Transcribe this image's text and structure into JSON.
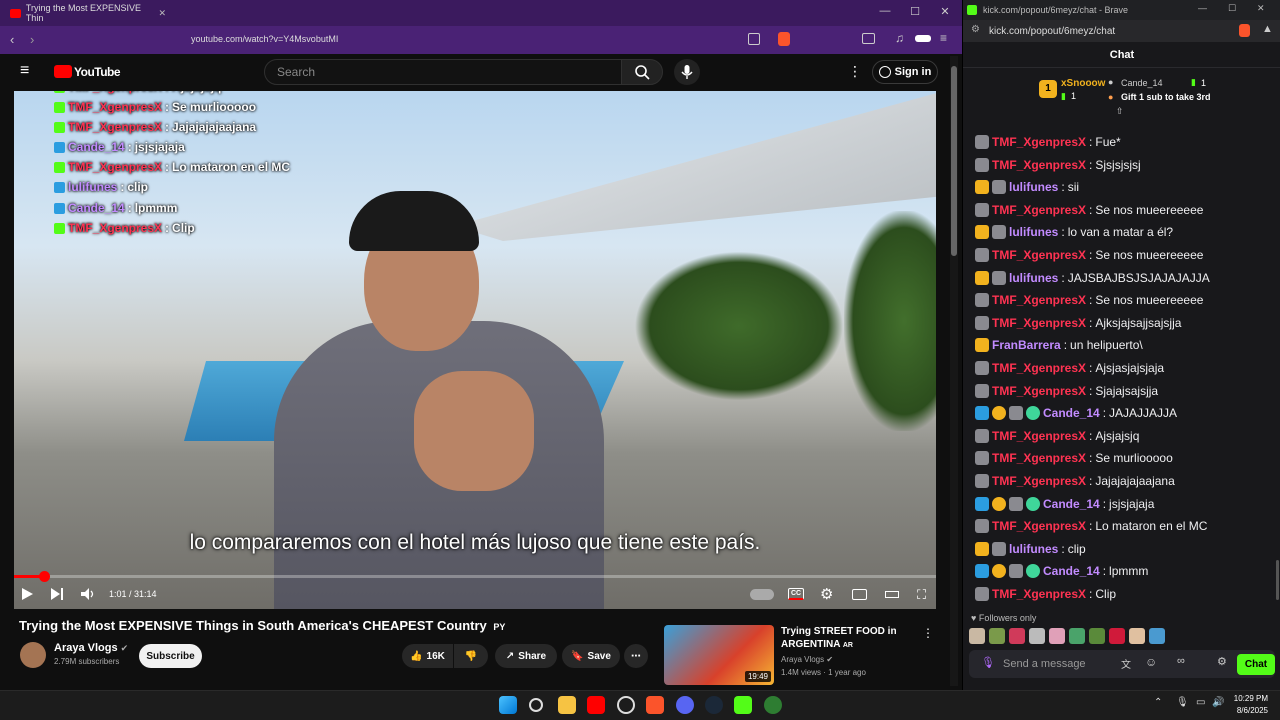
{
  "left_window": {
    "tab_title": "Trying the Most EXPENSIVE Thin",
    "url": "youtube.com/watch?v=Y4MsvobutMI",
    "controls": [
      "—",
      "☐",
      "✕"
    ]
  },
  "youtube": {
    "logo": "YouTube",
    "search_placeholder": "Search",
    "sign_in": "Sign in",
    "subtitle": "lo compararemos con el hotel más lujoso que tiene este país.",
    "time": "1:01 / 31:14",
    "progress_fraction": 0.033,
    "title": "Trying the Most EXPENSIVE Things in South America's CHEAPEST Country",
    "title_badge": "PY",
    "channel": "Araya Vlogs",
    "subscribers": "2.79M subscribers",
    "subscribe": "Subscribe",
    "likes": "16K",
    "share": "Share",
    "save": "Save",
    "recommended": {
      "title": "Trying STREET FOOD in ARGENTINA",
      "title_badge": "AR",
      "channel": "Araya Vlogs",
      "meta": "1.4M views · 1 year ago",
      "duration": "19:49"
    }
  },
  "overlay_chat": [
    {
      "name": "FranBarrera",
      "msg": "un helipuerto\\",
      "color": "gold"
    },
    {
      "name": "TMF_XgenpresX",
      "msg": "Ajsjasjajsjaja",
      "color": "red"
    },
    {
      "name": "TMF_XgenpresX",
      "msg": "Sjajajsajsjja",
      "color": "red"
    },
    {
      "name": "Cande_14",
      "msg": "JAJAJJAJJA",
      "color": "purple"
    },
    {
      "name": "TMF_XgenpresX",
      "msg": "Ajsjajsjq",
      "color": "red"
    },
    {
      "name": "TMF_XgenpresX",
      "msg": "Se murliooooo",
      "color": "red"
    },
    {
      "name": "TMF_XgenpresX",
      "msg": "Jajajajajaajana",
      "color": "red"
    },
    {
      "name": "Cande_14",
      "msg": "jsjsjajaja",
      "color": "purple"
    },
    {
      "name": "TMF_XgenpresX",
      "msg": "Lo mataron en el MC",
      "color": "red"
    },
    {
      "name": "lulifunes",
      "msg": "clip",
      "color": "purple"
    },
    {
      "name": "Cande_14",
      "msg": "lpmmm",
      "color": "purple"
    },
    {
      "name": "TMF_XgenpresX",
      "msg": "Clip",
      "color": "red"
    }
  ],
  "right_window": {
    "tab_title": "kick.com/popout/6meyz/chat - Brave",
    "url": "kick.com/popout/6meyz/chat",
    "header": "Chat",
    "pinned": {
      "leader_name": "xSnooow",
      "leader_count": "1",
      "second_name": "Cande_14",
      "second_count": "1",
      "gift_text": "Gift 1 sub to take 3rd"
    },
    "followers_only": "Followers only",
    "input_placeholder": "Send a message",
    "chat_button": "Chat"
  },
  "chat_messages": [
    {
      "name": "TMF_XgenpresX",
      "msg": "Fue*",
      "color": "#ff3352",
      "badges": [
        "shield"
      ]
    },
    {
      "name": "TMF_XgenpresX",
      "msg": "Sjsjsjsjsj",
      "color": "#ff3352",
      "badges": [
        "shield"
      ]
    },
    {
      "name": "lulifunes",
      "msg": "sii",
      "color": "#c28bff",
      "badges": [
        "crown",
        "shield"
      ]
    },
    {
      "name": "TMF_XgenpresX",
      "msg": "Se nos mueereeeee",
      "color": "#ff3352",
      "badges": [
        "shield"
      ]
    },
    {
      "name": "lulifunes",
      "msg": "lo van a matar a él?",
      "color": "#c28bff",
      "badges": [
        "crown",
        "shield"
      ]
    },
    {
      "name": "TMF_XgenpresX",
      "msg": "Se nos mueereeeee",
      "color": "#ff3352",
      "badges": [
        "shield"
      ]
    },
    {
      "name": "lulifunes",
      "msg": "JAJSBAJBSJSJAJAJAJJA",
      "color": "#c28bff",
      "badges": [
        "crown",
        "shield"
      ]
    },
    {
      "name": "TMF_XgenpresX",
      "msg": "Se nos mueereeeee",
      "color": "#ff3352",
      "badges": [
        "shield"
      ]
    },
    {
      "name": "TMF_XgenpresX",
      "msg": "Ajksjajsajjsajsjja",
      "color": "#ff3352",
      "badges": [
        "shield"
      ]
    },
    {
      "name": "FranBarrera",
      "msg": "un helipuerto\\",
      "color": "#c28bff",
      "badges": [
        "crown"
      ]
    },
    {
      "name": "TMF_XgenpresX",
      "msg": "Ajsjasjajsjaja",
      "color": "#ff3352",
      "badges": [
        "shield"
      ]
    },
    {
      "name": "TMF_XgenpresX",
      "msg": "Sjajajsajsjja",
      "color": "#ff3352",
      "badges": [
        "shield"
      ]
    },
    {
      "name": "Cande_14",
      "msg": "JAJAJJAJJA",
      "color": "#c28bff",
      "badges": [
        "sword",
        "coin",
        "shield",
        "gift"
      ]
    },
    {
      "name": "TMF_XgenpresX",
      "msg": "Ajsjajsjq",
      "color": "#ff3352",
      "badges": [
        "shield"
      ]
    },
    {
      "name": "TMF_XgenpresX",
      "msg": "Se murliooooo",
      "color": "#ff3352",
      "badges": [
        "shield"
      ]
    },
    {
      "name": "TMF_XgenpresX",
      "msg": "Jajajajajaajana",
      "color": "#ff3352",
      "badges": [
        "shield"
      ]
    },
    {
      "name": "Cande_14",
      "msg": "jsjsjajaja",
      "color": "#c28bff",
      "badges": [
        "sword",
        "coin",
        "shield",
        "gift"
      ]
    },
    {
      "name": "TMF_XgenpresX",
      "msg": "Lo mataron en el MC",
      "color": "#ff3352",
      "badges": [
        "shield"
      ]
    },
    {
      "name": "lulifunes",
      "msg": "clip",
      "color": "#c28bff",
      "badges": [
        "crown",
        "shield"
      ]
    },
    {
      "name": "Cande_14",
      "msg": "lpmmm",
      "color": "#c28bff",
      "badges": [
        "sword",
        "coin",
        "shield",
        "gift"
      ]
    },
    {
      "name": "TMF_XgenpresX",
      "msg": "Clip",
      "color": "#ff3352",
      "badges": [
        "shield"
      ]
    }
  ],
  "taskbar": {
    "time": "10:29 PM",
    "date": "8/6/2025"
  },
  "colors": {
    "kick_green": "#53fc18",
    "yt_red": "#ff0000",
    "title_purple": "#3b1a5e"
  }
}
